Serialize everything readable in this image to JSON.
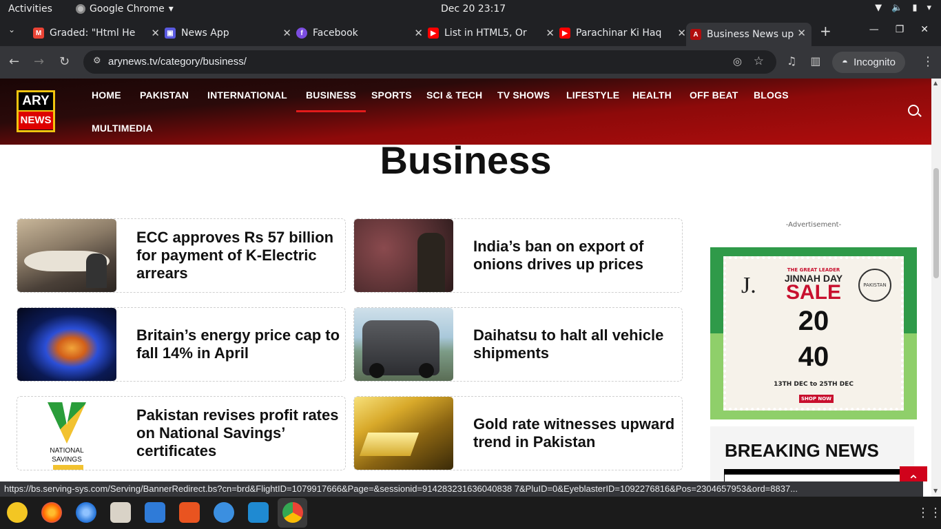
{
  "system": {
    "activities": "Activities",
    "app_name": "Google Chrome",
    "clock": "Dec 20  23:17"
  },
  "tabs": [
    {
      "title": "Graded: \"Html He",
      "icon": "gmail-icon",
      "color": "#ea4335"
    },
    {
      "title": "News App",
      "icon": "app-icon",
      "color": "#5a5ae0"
    },
    {
      "title": "Facebook",
      "icon": "facebook-icon",
      "color": "#7b4de0"
    },
    {
      "title": "List in HTML5, Or",
      "icon": "youtube-icon",
      "color": "#ff0000"
    },
    {
      "title": "Parachinar Ki Haq",
      "icon": "youtube-icon",
      "color": "#ff0000"
    },
    {
      "title": "Business News up",
      "icon": "arynews-icon",
      "color": "#b10d0d"
    }
  ],
  "toolbar": {
    "url": "arynews.tv/category/business/",
    "incognito": "Incognito"
  },
  "site": {
    "logo_top": "ARY",
    "logo_bottom": "NEWS",
    "menu": [
      "HOME",
      "PAKISTAN",
      "INTERNATIONAL",
      "BUSINESS",
      "SPORTS",
      "SCI & TECH",
      "TV SHOWS",
      "LIFESTYLE",
      "HEALTH",
      "OFF BEAT",
      "BLOGS",
      "MULTIMEDIA"
    ],
    "active_menu": "BUSINESS",
    "page_title": "Business"
  },
  "articles": [
    {
      "headline": "ECC approves Rs 57 billion for payment of K-Electric arrears"
    },
    {
      "headline": "India’s ban on export of onions drives up prices"
    },
    {
      "headline": "Britain’s energy price cap to fall 14% in April"
    },
    {
      "headline": "Daihatsu to halt all vehicle shipments"
    },
    {
      "headline": "Pakistan revises profit rates on National Savings’ certificates"
    },
    {
      "headline": "Gold rate witnesses upward trend in Pakistan"
    }
  ],
  "thumb_texts": {
    "national_savings": "NATIONAL SAVINGS"
  },
  "ad": {
    "label": "-Advertisement-",
    "brand": "J.",
    "seal": "PAKISTAN",
    "kicker": "THE GREAT LEADER",
    "title": "JINNAH DAY",
    "sale": "SALE",
    "flat1": "20",
    "flat2": "40",
    "dates": "13TH DEC to 25TH DEC",
    "cta": "SHOP NOW"
  },
  "breaking": {
    "heading": "BREAKING NEWS"
  },
  "status_url": "https://bs.serving-sys.com/Serving/BannerRedirect.bs?cn=brd&FlightID=1079917666&Page=&sessionid=914283231636040838 7&PluID=0&EyeblasterID=1092276816&Pos=2304657953&ord=8837...",
  "dock": [
    "rhythmbox-icon",
    "firefox-icon",
    "thunderbird-icon",
    "files-icon",
    "writer-icon",
    "appcenter-icon",
    "help-icon",
    "vscode-icon",
    "chrome-icon"
  ]
}
